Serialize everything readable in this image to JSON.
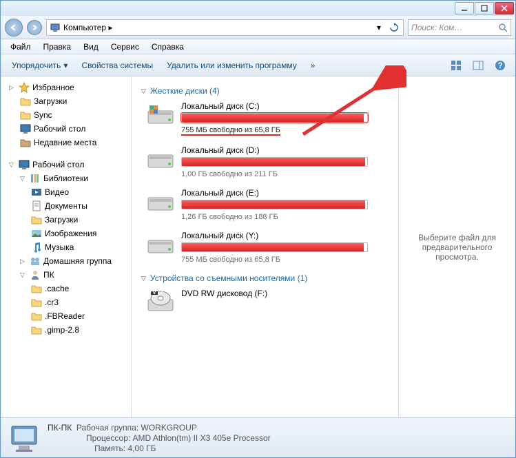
{
  "titlebar": {
    "min": "−",
    "max": "□",
    "close": "×"
  },
  "nav": {
    "path_label": "Компьютер",
    "path_sep": "▸",
    "search_placeholder": "Поиск: Ком…"
  },
  "menubar": [
    "Файл",
    "Правка",
    "Вид",
    "Сервис",
    "Справка"
  ],
  "toolbar": {
    "organize": "Упорядочить",
    "sysprops": "Свойства системы",
    "uninstall": "Удалить или изменить программу",
    "more": "»"
  },
  "sidebar": {
    "favorites": {
      "label": "Избранное",
      "items": [
        "Загрузки",
        "Sync",
        "Рабочий стол",
        "Недавние места"
      ]
    },
    "desktop": {
      "label": "Рабочий стол",
      "libraries": {
        "label": "Библиотеки",
        "items": [
          "Видео",
          "Документы",
          "Загрузки",
          "Изображения",
          "Музыка"
        ]
      },
      "homegroup": "Домашняя группа",
      "pc": {
        "label": "ПК",
        "items": [
          ".cache",
          ".cr3",
          ".FBReader",
          ".gimp-2.8"
        ]
      }
    }
  },
  "content": {
    "hdd_header": "Жесткие диски (4)",
    "removable_header": "Устройства со съемными носителями (1)",
    "drives": [
      {
        "name": "Локальный диск (C:)",
        "free": "755 МБ свободно из 65,8 ГБ",
        "fill_pct": 98,
        "selected": true,
        "os": true
      },
      {
        "name": "Локальный диск (D:)",
        "free": "1,00 ГБ свободно из 211 ГБ",
        "fill_pct": 99,
        "selected": false,
        "os": false
      },
      {
        "name": "Локальный диск (E:)",
        "free": "1,26 ГБ свободно из 188 ГБ",
        "fill_pct": 99,
        "selected": false,
        "os": false
      },
      {
        "name": "Локальный диск (Y:)",
        "free": "755 МБ свободно из 65,8 ГБ",
        "fill_pct": 98,
        "selected": false,
        "os": false
      }
    ],
    "dvd": "DVD RW дисковод (F:)"
  },
  "preview": {
    "text": "Выберите файл для предварительного просмотра."
  },
  "status": {
    "name": "ПК-ПК",
    "workgroup_label": "Рабочая группа:",
    "workgroup": "WORKGROUP",
    "cpu_label": "Процессор:",
    "cpu": "AMD Athlon(tm) II X3 405e Processor",
    "mem_label": "Память:",
    "mem": "4,00 ГБ"
  }
}
